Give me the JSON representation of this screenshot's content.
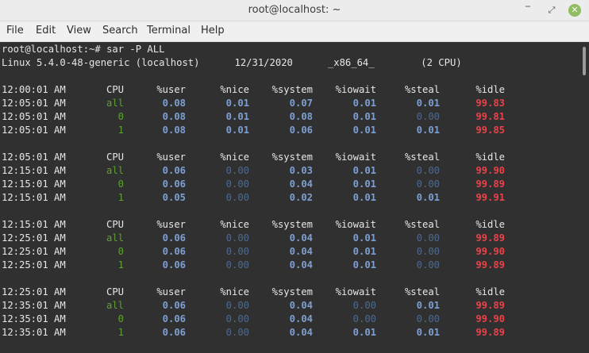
{
  "window": {
    "title": "root@localhost: ~",
    "min_glyph": "‾",
    "max_glyph": "⤢",
    "close_glyph": "✕"
  },
  "menu": [
    "File",
    "Edit",
    "View",
    "Search",
    "Terminal",
    "Help"
  ],
  "terminal": {
    "prompt": "root@localhost:~# sar -P ALL",
    "sysinfo": "Linux 5.4.0-48-generic (localhost)      12/31/2020      _x86_64_        (2 CPU)",
    "header_labels": [
      "CPU",
      "%user",
      "%nice",
      "%system",
      "%iowait",
      "%steal",
      "%idle"
    ],
    "blocks": [
      {
        "header_time": "12:00:01 AM",
        "rows": [
          {
            "time": "12:05:01 AM",
            "cpu": "all",
            "user": "0.08",
            "nice": "0.01",
            "system": "0.07",
            "iowait": "0.01",
            "steal": "0.01",
            "idle": "99.83"
          },
          {
            "time": "12:05:01 AM",
            "cpu": "0",
            "user": "0.08",
            "nice": "0.01",
            "system": "0.08",
            "iowait": "0.01",
            "steal": "0.00",
            "idle": "99.81"
          },
          {
            "time": "12:05:01 AM",
            "cpu": "1",
            "user": "0.08",
            "nice": "0.01",
            "system": "0.06",
            "iowait": "0.01",
            "steal": "0.01",
            "idle": "99.85"
          }
        ]
      },
      {
        "header_time": "12:05:01 AM",
        "rows": [
          {
            "time": "12:15:01 AM",
            "cpu": "all",
            "user": "0.06",
            "nice": "0.00",
            "system": "0.03",
            "iowait": "0.01",
            "steal": "0.00",
            "idle": "99.90"
          },
          {
            "time": "12:15:01 AM",
            "cpu": "0",
            "user": "0.06",
            "nice": "0.00",
            "system": "0.04",
            "iowait": "0.01",
            "steal": "0.00",
            "idle": "99.89"
          },
          {
            "time": "12:15:01 AM",
            "cpu": "1",
            "user": "0.05",
            "nice": "0.00",
            "system": "0.02",
            "iowait": "0.01",
            "steal": "0.01",
            "idle": "99.91"
          }
        ]
      },
      {
        "header_time": "12:15:01 AM",
        "rows": [
          {
            "time": "12:25:01 AM",
            "cpu": "all",
            "user": "0.06",
            "nice": "0.00",
            "system": "0.04",
            "iowait": "0.01",
            "steal": "0.00",
            "idle": "99.89"
          },
          {
            "time": "12:25:01 AM",
            "cpu": "0",
            "user": "0.06",
            "nice": "0.00",
            "system": "0.04",
            "iowait": "0.01",
            "steal": "0.00",
            "idle": "99.90"
          },
          {
            "time": "12:25:01 AM",
            "cpu": "1",
            "user": "0.06",
            "nice": "0.00",
            "system": "0.04",
            "iowait": "0.01",
            "steal": "0.00",
            "idle": "99.89"
          }
        ]
      },
      {
        "header_time": "12:25:01 AM",
        "rows": [
          {
            "time": "12:35:01 AM",
            "cpu": "all",
            "user": "0.06",
            "nice": "0.00",
            "system": "0.04",
            "iowait": "0.00",
            "steal": "0.01",
            "idle": "99.89"
          },
          {
            "time": "12:35:01 AM",
            "cpu": "0",
            "user": "0.06",
            "nice": "0.00",
            "system": "0.04",
            "iowait": "0.00",
            "steal": "0.00",
            "idle": "99.90"
          },
          {
            "time": "12:35:01 AM",
            "cpu": "1",
            "user": "0.06",
            "nice": "0.00",
            "system": "0.04",
            "iowait": "0.01",
            "steal": "0.01",
            "idle": "99.89"
          }
        ]
      }
    ]
  },
  "colors": {
    "cpu_id": "#5fa132",
    "value": "#7f9fd0",
    "zero_value": "#4d6a8e",
    "idle": "#e8434a",
    "terminal_bg": "#303030"
  }
}
